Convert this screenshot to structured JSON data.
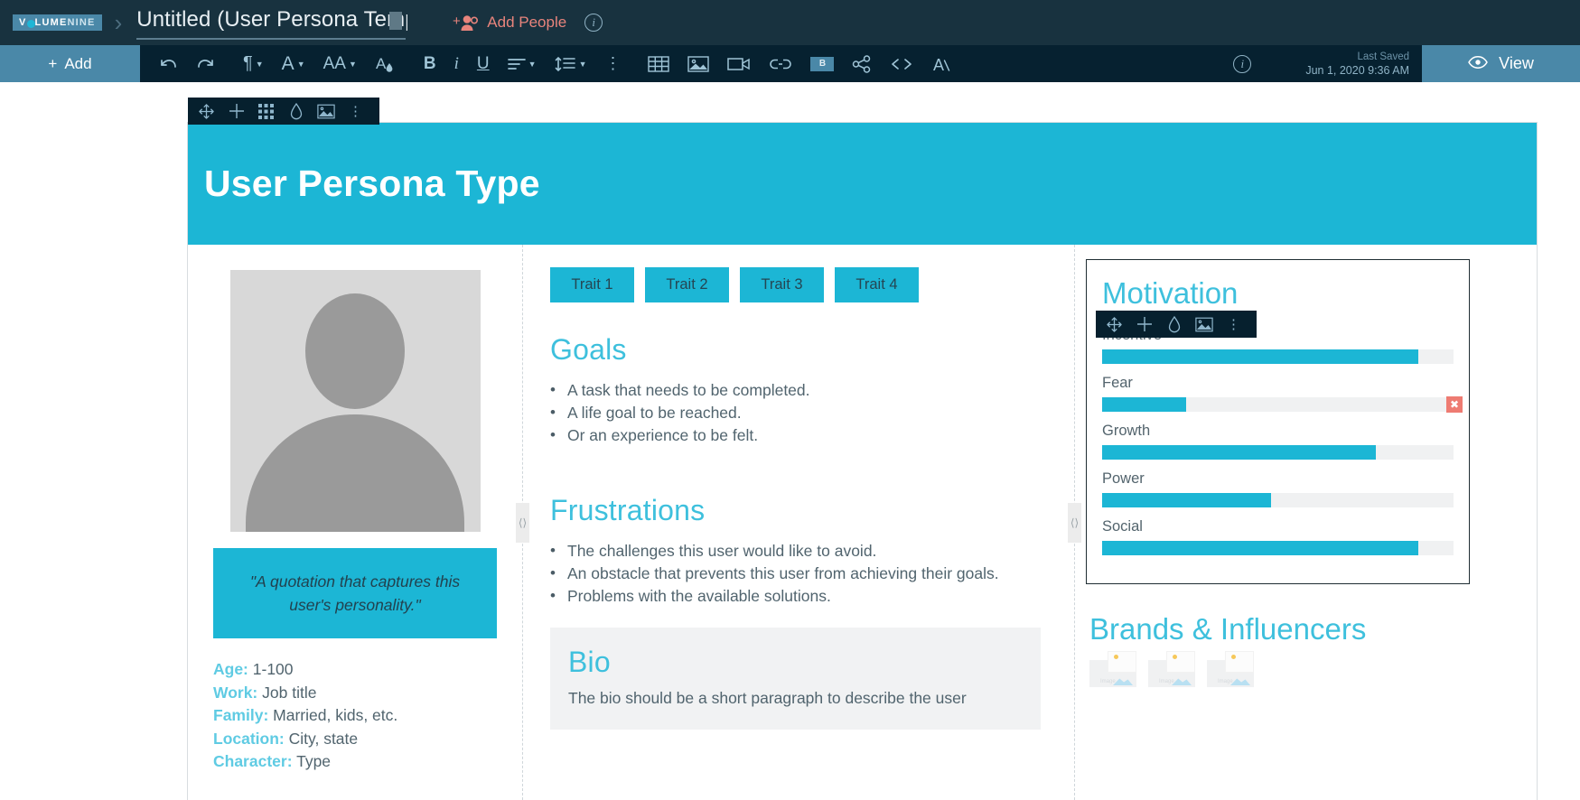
{
  "topbar": {
    "logo_part1": "V",
    "logo_part2": "LUME",
    "logo_part3": "NINE",
    "breadcrumb_separator": "›",
    "doc_title": "Untitled (User Persona Template)",
    "add_people_label": "Add People",
    "info_glyph": "i"
  },
  "toolbar": {
    "add_label": "Add",
    "add_plus": "+",
    "items": [
      {
        "name": "undo-icon",
        "glyph": "↶"
      },
      {
        "name": "redo-icon",
        "glyph": "↷"
      },
      {
        "name": "paragraph-style-icon",
        "glyph": "¶"
      },
      {
        "name": "font-family-icon",
        "glyph": "A"
      },
      {
        "name": "font-size-icon",
        "glyph": "AA"
      },
      {
        "name": "text-color-icon",
        "glyph": "A"
      },
      {
        "name": "bold-icon",
        "glyph": "B"
      },
      {
        "name": "italic-icon",
        "glyph": "i"
      },
      {
        "name": "underline-icon",
        "glyph": "U"
      },
      {
        "name": "align-icon",
        "glyph": "align"
      },
      {
        "name": "line-spacing-icon",
        "glyph": "spacing"
      },
      {
        "name": "more-options-icon",
        "glyph": "⋮"
      },
      {
        "name": "table-icon",
        "glyph": "table"
      },
      {
        "name": "image-icon",
        "glyph": "image"
      },
      {
        "name": "video-icon",
        "glyph": "video"
      },
      {
        "name": "link-icon",
        "glyph": "link"
      },
      {
        "name": "button-icon",
        "glyph": "B"
      },
      {
        "name": "share-icon",
        "glyph": "share"
      },
      {
        "name": "code-icon",
        "glyph": "<>"
      },
      {
        "name": "clear-formatting-icon",
        "glyph": "A/"
      }
    ],
    "last_saved_label": "Last Saved",
    "last_saved_value": "Jun 1, 2020 9:36 AM",
    "view_label": "View",
    "view_icon": "eye-icon"
  },
  "left_rail": {
    "items": [
      {
        "name": "rail-add-icon",
        "glyph": "+"
      },
      {
        "name": "rail-image-icon",
        "glyph": "image"
      },
      {
        "name": "rail-more-icon",
        "glyph": "⋮"
      }
    ]
  },
  "block_toolbar_top": {
    "items": [
      {
        "name": "move-icon",
        "glyph": "move"
      },
      {
        "name": "add-icon",
        "glyph": "+"
      },
      {
        "name": "grid-icon",
        "glyph": "grid"
      },
      {
        "name": "color-drop-icon",
        "glyph": "drop"
      },
      {
        "name": "image-icon",
        "glyph": "image"
      },
      {
        "name": "more-icon",
        "glyph": "⋮"
      }
    ]
  },
  "block_toolbar_motivation": {
    "items": [
      {
        "name": "move-icon",
        "glyph": "move"
      },
      {
        "name": "add-icon",
        "glyph": "+"
      },
      {
        "name": "color-drop-icon",
        "glyph": "drop"
      },
      {
        "name": "image-icon",
        "glyph": "image"
      },
      {
        "name": "more-icon",
        "glyph": "⋮"
      }
    ]
  },
  "page": {
    "hero_title": "User Persona Type",
    "left_column": {
      "quote": "\"A quotation that captures this user's personality.\"",
      "demographics": [
        {
          "key": "Age:",
          "value": "1-100"
        },
        {
          "key": "Work:",
          "value": "Job title"
        },
        {
          "key": "Family:",
          "value": "Married, kids, etc."
        },
        {
          "key": "Location:",
          "value": "City, state"
        },
        {
          "key": "Character:",
          "value": "Type"
        }
      ]
    },
    "middle_column": {
      "traits": [
        "Trait 1",
        "Trait 2",
        "Trait 3",
        "Trait 4"
      ],
      "goals_heading": "Goals",
      "goals": [
        "A task that needs to be completed.",
        "A life goal to be reached.",
        "Or an experience to be felt."
      ],
      "frustrations_heading": "Frustrations",
      "frustrations": [
        "The challenges this user would like to avoid.",
        "An obstacle that prevents this user from achieving their goals.",
        "Problems with the available solutions."
      ],
      "bio_heading": "Bio",
      "bio_text": "The bio should be a short paragraph to describe the user"
    },
    "right_column": {
      "motivation_heading": "Motivation",
      "brands_heading": "Brands & Influencers",
      "delete_glyph": "✖",
      "brand_placeholders": [
        "Image",
        "Image",
        "Image"
      ]
    }
  },
  "chart_data": {
    "type": "bar",
    "title": "Motivation",
    "orientation": "horizontal",
    "categories": [
      "Incentive",
      "Fear",
      "Growth",
      "Power",
      "Social"
    ],
    "values": [
      90,
      24,
      78,
      48,
      90
    ],
    "ylim": [
      0,
      100
    ],
    "xlabel": "",
    "ylabel": "",
    "grid": false,
    "legend": "none",
    "bar_color": "#1cb6d5",
    "track_color": "#f0f1f2"
  },
  "colors": {
    "brand_cyan": "#1cb6d5",
    "heading_cyan": "#3ec0dd",
    "topbar_navy": "#18323f",
    "toolbar_navy": "#062130",
    "accent_blue": "#4a88a8",
    "coral": "#e8847c",
    "delete_red": "#ee7b72"
  }
}
